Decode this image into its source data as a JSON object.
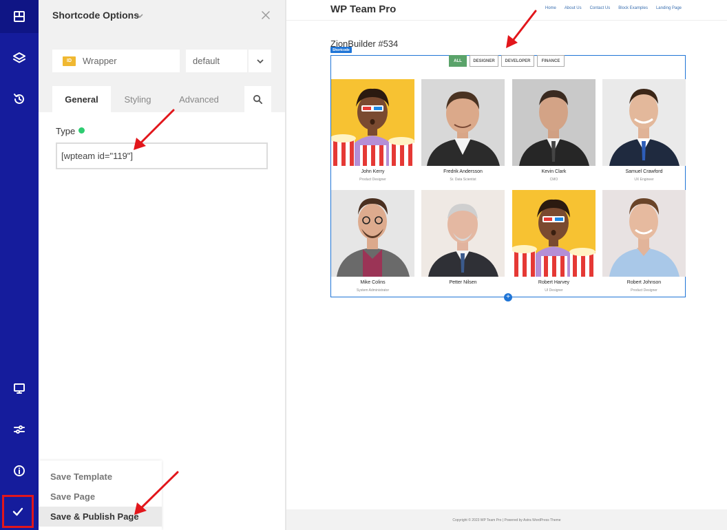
{
  "panel": {
    "title": "Shortcode Options",
    "id_badge": "ID",
    "element_name": "Wrapper",
    "state_value": "default",
    "tabs": [
      "General",
      "Styling",
      "Advanced"
    ],
    "type_label": "Type",
    "shortcode_value": "[wpteam id=\"119\"]"
  },
  "save_menu": {
    "items": [
      "Save Template",
      "Save Page",
      "Save & Publish Page"
    ]
  },
  "preview": {
    "site_title": "WP Team Pro",
    "nav": [
      "Home",
      "About Us",
      "Contact Us",
      "Block Examples",
      "Landing Page"
    ],
    "page_heading": "ZionBuilder #534",
    "shortcode_tag": "Shortcode",
    "filters": [
      "ALL",
      "DESIGNER",
      "DEVELOPER",
      "FINANCE"
    ],
    "members": [
      {
        "name": "John Kerry",
        "role": "Product Designer"
      },
      {
        "name": "Fredrik Andersson",
        "role": "Sr. Data Scientist"
      },
      {
        "name": "Kevin Clark",
        "role": "CMO"
      },
      {
        "name": "Samuel Crawford",
        "role": "UX Engineer"
      },
      {
        "name": "Mike Colins",
        "role": "System Administrator"
      },
      {
        "name": "Petter Nilsen",
        "role": ""
      },
      {
        "name": "Robert Harvey",
        "role": "UI Designer"
      },
      {
        "name": "Robert Johnson",
        "role": "Product Designer"
      }
    ],
    "footer": "Copyright © 2023 WP Team Pro | Powered by Astra WordPress Theme"
  },
  "colors": {
    "rail": "#151c9c",
    "accent": "#1e74d6",
    "filter_active": "#5aa36a",
    "arrow": "#e2161b",
    "status_dot": "#2ecc71"
  }
}
